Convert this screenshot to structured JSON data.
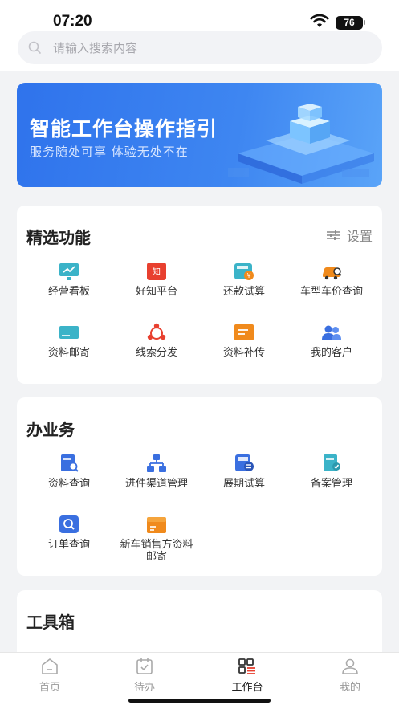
{
  "status_bar": {
    "time": "07:20",
    "battery": "76"
  },
  "search": {
    "placeholder": "请输入搜索内容"
  },
  "banner": {
    "title": "智能工作台操作指引",
    "subtitle": "服务随处可享   体验无处不在"
  },
  "featured": {
    "title": "精选功能",
    "settings_label": "设置",
    "items": [
      {
        "label": "经营看板",
        "icon": "dashboard-icon",
        "color": "#3bb3c8"
      },
      {
        "label": "好知平台",
        "icon": "knowledge-icon",
        "color": "#e8402f"
      },
      {
        "label": "还款试算",
        "icon": "repayment-calc-icon",
        "color": "#3bb3c8"
      },
      {
        "label": "车型车价查询",
        "icon": "car-search-icon",
        "color": "#f08a1c"
      },
      {
        "label": "资料邮寄",
        "icon": "mail-card-icon",
        "color": "#3bb3c8"
      },
      {
        "label": "线索分发",
        "icon": "distribute-icon",
        "color": "#e8402f"
      },
      {
        "label": "资料补传",
        "icon": "upload-doc-icon",
        "color": "#f08a1c"
      },
      {
        "label": "我的客户",
        "icon": "customers-icon",
        "color": "#3a6fe0"
      }
    ]
  },
  "business": {
    "title": "办业务",
    "items": [
      {
        "label": "资料查询",
        "icon": "doc-search-icon",
        "color": "#3a6fe0"
      },
      {
        "label": "进件渠道管理",
        "icon": "channel-icon",
        "color": "#3a6fe0"
      },
      {
        "label": "展期试算",
        "icon": "extension-calc-icon",
        "color": "#3a6fe0"
      },
      {
        "label": "备案管理",
        "icon": "filing-icon",
        "color": "#3bb3c8"
      },
      {
        "label": "订单查询",
        "icon": "order-search-icon",
        "color": "#3a6fe0"
      },
      {
        "label": "新车销售方资料邮寄",
        "icon": "box-icon",
        "color": "#f08a1c"
      }
    ]
  },
  "toolbox": {
    "title": "工具箱"
  },
  "tabbar": {
    "items": [
      {
        "label": "首页",
        "icon": "home-icon"
      },
      {
        "label": "待办",
        "icon": "todo-icon"
      },
      {
        "label": "工作台",
        "icon": "workbench-icon",
        "active": true
      },
      {
        "label": "我的",
        "icon": "profile-icon"
      }
    ]
  }
}
